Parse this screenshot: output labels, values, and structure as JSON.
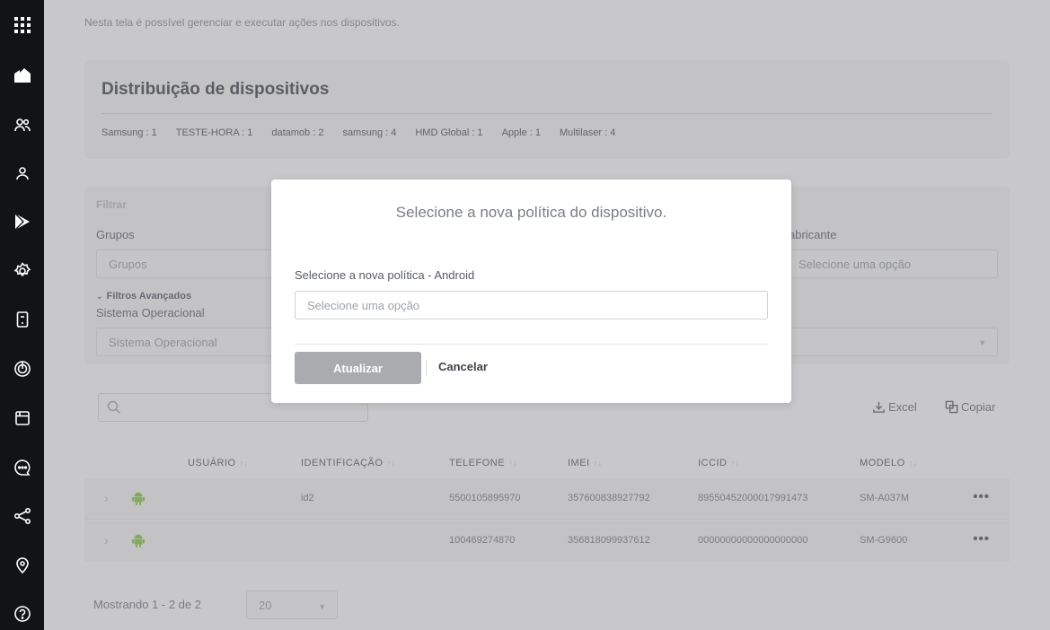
{
  "sidebar": {
    "items": [
      {
        "icon": "apps-grid-icon"
      },
      {
        "icon": "company-icon"
      },
      {
        "icon": "users-icon"
      },
      {
        "icon": "user-icon"
      },
      {
        "icon": "play-store-icon"
      },
      {
        "icon": "settings-icon"
      },
      {
        "icon": "device-icon"
      },
      {
        "icon": "location-target-icon"
      },
      {
        "icon": "calendar-icon"
      },
      {
        "icon": "chat-icon"
      },
      {
        "icon": "share-icon"
      },
      {
        "icon": "map-pin-icon"
      },
      {
        "icon": "help-icon"
      }
    ]
  },
  "intro": "Nesta tela é possível gerenciar e executar ações nos dispositivos.",
  "distribution": {
    "title": "Distribuição de dispositivos",
    "items": [
      "Samsung : 1",
      "TESTE-HORA : 1",
      "datamob : 2",
      "samsung : 4",
      "HMD Global : 1",
      "Apple : 1",
      "Multilaser : 4"
    ]
  },
  "filter": {
    "title": "Filtrar",
    "groups_label": "Grupos",
    "groups_placeholder": "Grupos",
    "manufacturer_label": "abricante",
    "manufacturer_placeholder": "Selecione uma opção",
    "advanced_label": "Filtros Avançados",
    "os_label": "Sistema Operacional",
    "os_placeholder": "Sistema Operacional"
  },
  "toolbar": {
    "excel": "Excel",
    "copy": "Copiar"
  },
  "table": {
    "columns": [
      "USUÁRIO",
      "IDENTIFICAÇÃO",
      "TELEFONE",
      "IMEI",
      "ICCID",
      "MODELO"
    ],
    "rows": [
      {
        "user": "",
        "identification": "id2",
        "phone": "5500105895970",
        "imei": "357600838927792",
        "iccid": "89550452000017991473",
        "model": "SM-A037M"
      },
      {
        "user": "",
        "identification": "",
        "phone": "100469274870",
        "imei": "356818099937612",
        "iccid": "00000000000000000000",
        "model": "SM-G9600"
      }
    ]
  },
  "pager": {
    "text": "Mostrando 1 - 2 de 2",
    "page_size": "20"
  },
  "modal": {
    "title": "Selecione a nova política do dispositivo.",
    "label": "Selecione a nova política - Android",
    "placeholder": "Selecione uma opção",
    "update_button": "Atualizar",
    "cancel_button": "Cancelar"
  },
  "colors": {
    "sidebar": "#111315",
    "android": "#8bc34a",
    "update_button": "#a9abae"
  }
}
